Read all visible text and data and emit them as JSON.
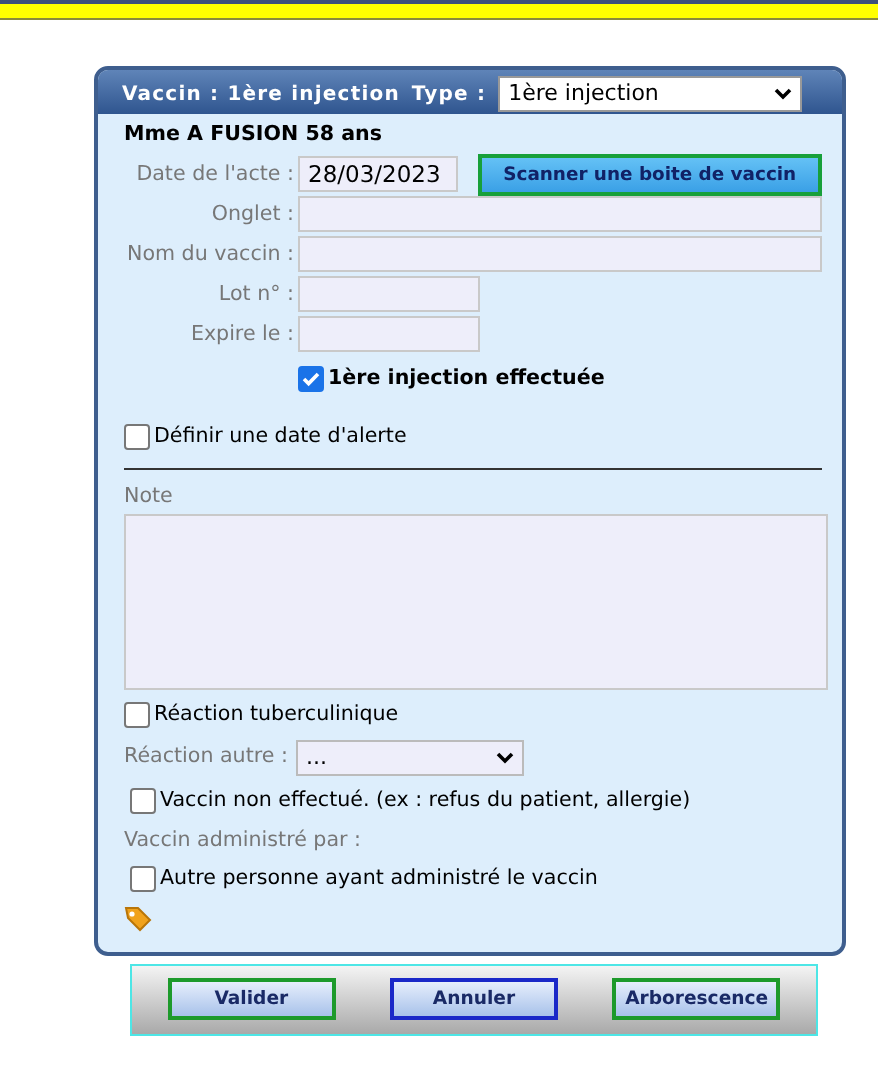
{
  "dialog": {
    "title": "Vaccin : 1ère injection",
    "type_label": "Type :",
    "type_value": "1ère injection"
  },
  "patient": "Mme A FUSION 58 ans",
  "date": {
    "label": "Date de l'acte :",
    "value": "28/03/2023"
  },
  "scan_button": "Scanner une boite de vaccin",
  "fields": [
    {
      "label": "Onglet :",
      "kind": "wide"
    },
    {
      "label": "Nom du vaccin :",
      "kind": "wide"
    },
    {
      "label": "Lot n° :",
      "kind": "short"
    },
    {
      "label": "Expire le :",
      "kind": "short"
    }
  ],
  "injection_done": {
    "label": "1ère injection effectuée",
    "checked": true
  },
  "alert_date": {
    "label": "Définir une date d'alerte",
    "checked": false
  },
  "note": {
    "label": "Note"
  },
  "tuberculin": {
    "label": "Réaction tuberculinique",
    "checked": false
  },
  "other_reaction": {
    "label": "Réaction autre :",
    "value": "..."
  },
  "not_done": {
    "label": "Vaccin non effectué. (ex : refus du patient, allergie)",
    "checked": false
  },
  "administered_by": "Vaccin administré par :",
  "other_person": {
    "label": "Autre personne ayant administré le vaccin",
    "checked": false
  },
  "buttons": [
    {
      "label": "Valider",
      "kind": "confirm"
    },
    {
      "label": "Annuler",
      "kind": "cancel"
    },
    {
      "label": "Arborescence",
      "kind": "confirm"
    }
  ]
}
